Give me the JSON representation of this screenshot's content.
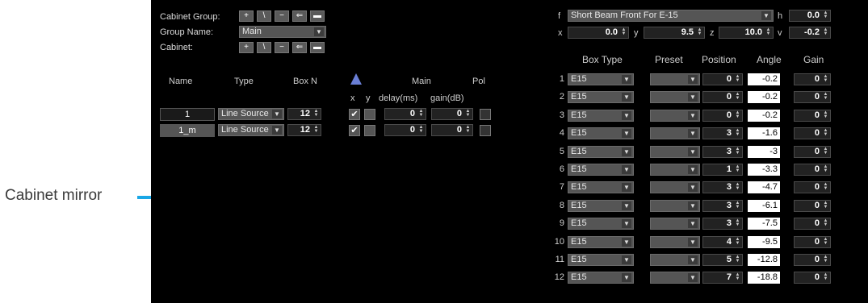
{
  "callout": {
    "label": "Cabinet mirror",
    "color": "#1aa7e6"
  },
  "left": {
    "cabinet_group_label": "Cabinet Group:",
    "group_name_label": "Group Name:",
    "group_name_value": "Main",
    "cabinet_label": "Cabinet:",
    "headers": {
      "name": "Name",
      "type": "Type",
      "box_n": "Box N",
      "main": "Main",
      "pol": "Pol",
      "x": "x",
      "y": "y",
      "delay": "delay(ms)",
      "gain": "gain(dB)"
    },
    "rows": [
      {
        "name": "1",
        "type": "Line Source",
        "box_n": "12",
        "x_checked": "✔",
        "delay": "0",
        "gain": "0"
      },
      {
        "name": "1_m",
        "type": "Line Source",
        "box_n": "12",
        "x_checked": "✔",
        "delay": "0",
        "gain": "0"
      }
    ]
  },
  "right": {
    "preset_prefix": "f",
    "preset_value": "Short Beam Front For E-15",
    "h_label": "h",
    "h_value": "0.0",
    "x_label": "x",
    "x_value": "0.0",
    "y_label": "y",
    "y_value": "9.5",
    "z_label": "z",
    "z_value": "10.0",
    "v_label": "v",
    "v_value": "-0.2",
    "headers": {
      "box_type": "Box Type",
      "preset": "Preset",
      "position": "Position",
      "angle": "Angle",
      "gain": "Gain"
    },
    "rows": [
      {
        "n": "1",
        "box_type": "E15",
        "position": "0",
        "angle": "-0.2",
        "gain": "0"
      },
      {
        "n": "2",
        "box_type": "E15",
        "position": "0",
        "angle": "-0.2",
        "gain": "0"
      },
      {
        "n": "3",
        "box_type": "E15",
        "position": "0",
        "angle": "-0.2",
        "gain": "0"
      },
      {
        "n": "4",
        "box_type": "E15",
        "position": "3",
        "angle": "-1.6",
        "gain": "0"
      },
      {
        "n": "5",
        "box_type": "E15",
        "position": "3",
        "angle": "-3",
        "gain": "0"
      },
      {
        "n": "6",
        "box_type": "E15",
        "position": "1",
        "angle": "-3.3",
        "gain": "0"
      },
      {
        "n": "7",
        "box_type": "E15",
        "position": "3",
        "angle": "-4.7",
        "gain": "0"
      },
      {
        "n": "8",
        "box_type": "E15",
        "position": "3",
        "angle": "-6.1",
        "gain": "0"
      },
      {
        "n": "9",
        "box_type": "E15",
        "position": "3",
        "angle": "-7.5",
        "gain": "0"
      },
      {
        "n": "10",
        "box_type": "E15",
        "position": "4",
        "angle": "-9.5",
        "gain": "0"
      },
      {
        "n": "11",
        "box_type": "E15",
        "position": "5",
        "angle": "-12.8",
        "gain": "0"
      },
      {
        "n": "12",
        "box_type": "E15",
        "position": "7",
        "angle": "-18.8",
        "gain": "0"
      }
    ]
  }
}
